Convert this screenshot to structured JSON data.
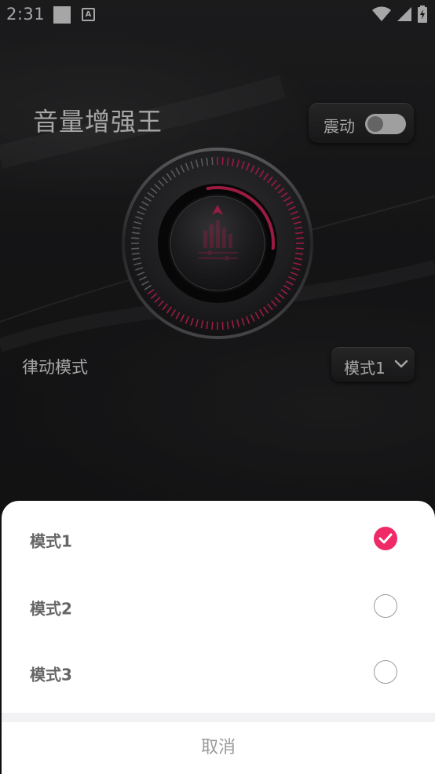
{
  "status_bar": {
    "time": "2:31",
    "notif_icon": "A"
  },
  "app": {
    "title": "音量增强王"
  },
  "vibrate": {
    "label": "震动",
    "enabled": false
  },
  "rhythm": {
    "label": "律动模式",
    "selected": "模式1"
  },
  "colors": {
    "accent": "#ef2a66",
    "background": "#1f1f21"
  },
  "sheet": {
    "options": [
      {
        "label": "模式1",
        "selected": true
      },
      {
        "label": "模式2",
        "selected": false
      },
      {
        "label": "模式3",
        "selected": false
      }
    ],
    "cancel": "取消"
  }
}
